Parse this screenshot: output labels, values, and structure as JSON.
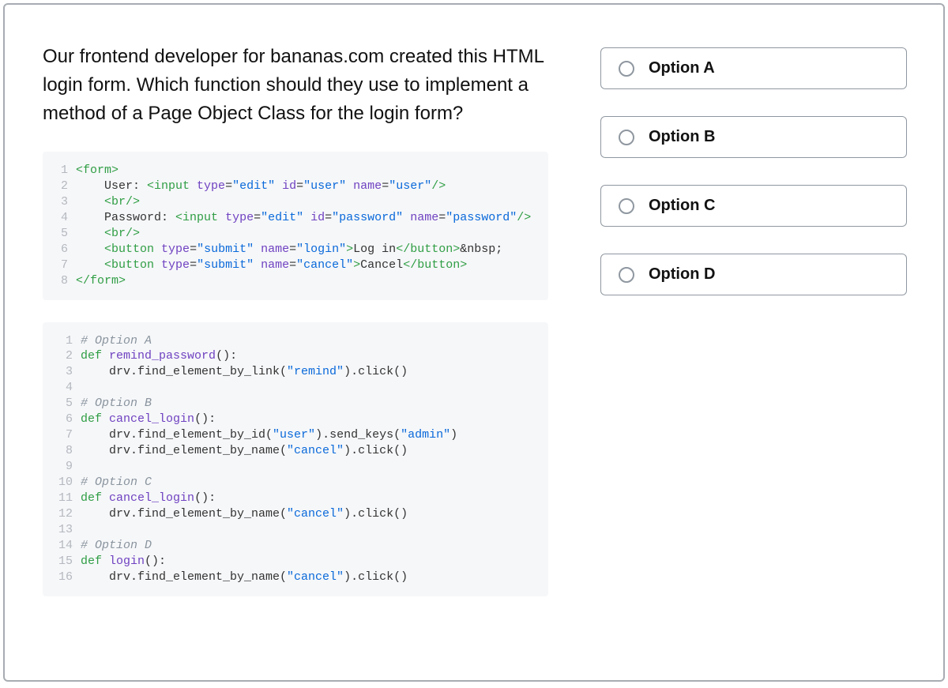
{
  "question": "Our frontend developer for bananas.com created this HTML login form. Which function should they use to implement a method of a Page Object Class for the login form?",
  "code1": {
    "lines": [
      {
        "n": "1",
        "h": "<span class='tag'>&lt;form&gt;</span>"
      },
      {
        "n": "2",
        "h": "    User: <span class='tag'>&lt;input</span> <span class='attr'>type</span>=<span class='str'>\"edit\"</span> <span class='attr'>id</span>=<span class='str'>\"user\"</span> <span class='attr'>name</span>=<span class='str'>\"user\"</span><span class='tag'>/&gt;</span>"
      },
      {
        "n": "3",
        "h": "    <span class='tag'>&lt;br/&gt;</span>"
      },
      {
        "n": "4",
        "h": "    Password: <span class='tag'>&lt;input</span> <span class='attr'>type</span>=<span class='str'>\"edit\"</span> <span class='attr'>id</span>=<span class='str'>\"password\"</span> <span class='attr'>name</span>=<span class='str'>\"password\"</span><span class='tag'>/&gt;</span>"
      },
      {
        "n": "5",
        "h": "    <span class='tag'>&lt;br/&gt;</span>"
      },
      {
        "n": "6",
        "h": "    <span class='tag'>&lt;button</span> <span class='attr'>type</span>=<span class='str'>\"submit\"</span> <span class='attr'>name</span>=<span class='str'>\"login\"</span><span class='tag'>&gt;</span>Log in<span class='tag'>&lt;/button&gt;</span>&amp;nbsp;"
      },
      {
        "n": "7",
        "h": "    <span class='tag'>&lt;button</span> <span class='attr'>type</span>=<span class='str'>\"submit\"</span> <span class='attr'>name</span>=<span class='str'>\"cancel\"</span><span class='tag'>&gt;</span>Cancel<span class='tag'>&lt;/button&gt;</span>"
      },
      {
        "n": "8",
        "h": "<span class='tag'>&lt;/form&gt;</span>"
      }
    ]
  },
  "code2": {
    "lines": [
      {
        "n": "1",
        "h": "<span class='com'># Option A</span>"
      },
      {
        "n": "2",
        "h": "<span class='kw'>def</span> <span class='func'>remind_password</span>():"
      },
      {
        "n": "3",
        "h": "    drv.find_element_by_link(<span class='str'>\"remind\"</span>).click()"
      },
      {
        "n": "4",
        "h": ""
      },
      {
        "n": "5",
        "h": "<span class='com'># Option B</span>"
      },
      {
        "n": "6",
        "h": "<span class='kw'>def</span> <span class='func'>cancel_login</span>():"
      },
      {
        "n": "7",
        "h": "    drv.find_element_by_id(<span class='str'>\"user\"</span>).send_keys(<span class='str'>\"admin\"</span>)"
      },
      {
        "n": "8",
        "h": "    drv.find_element_by_name(<span class='str'>\"cancel\"</span>).click()"
      },
      {
        "n": "9",
        "h": ""
      },
      {
        "n": "10",
        "h": "<span class='com'># Option C</span>"
      },
      {
        "n": "11",
        "h": "<span class='kw'>def</span> <span class='func'>cancel_login</span>():"
      },
      {
        "n": "12",
        "h": "    drv.find_element_by_name(<span class='str'>\"cancel\"</span>).click()"
      },
      {
        "n": "13",
        "h": ""
      },
      {
        "n": "14",
        "h": "<span class='com'># Option D</span>"
      },
      {
        "n": "15",
        "h": "<span class='kw'>def</span> <span class='func'>login</span>():"
      },
      {
        "n": "16",
        "h": "    drv.find_element_by_name(<span class='str'>\"cancel\"</span>).click()"
      }
    ]
  },
  "options": {
    "a": "Option A",
    "b": "Option B",
    "c": "Option C",
    "d": "Option D"
  }
}
